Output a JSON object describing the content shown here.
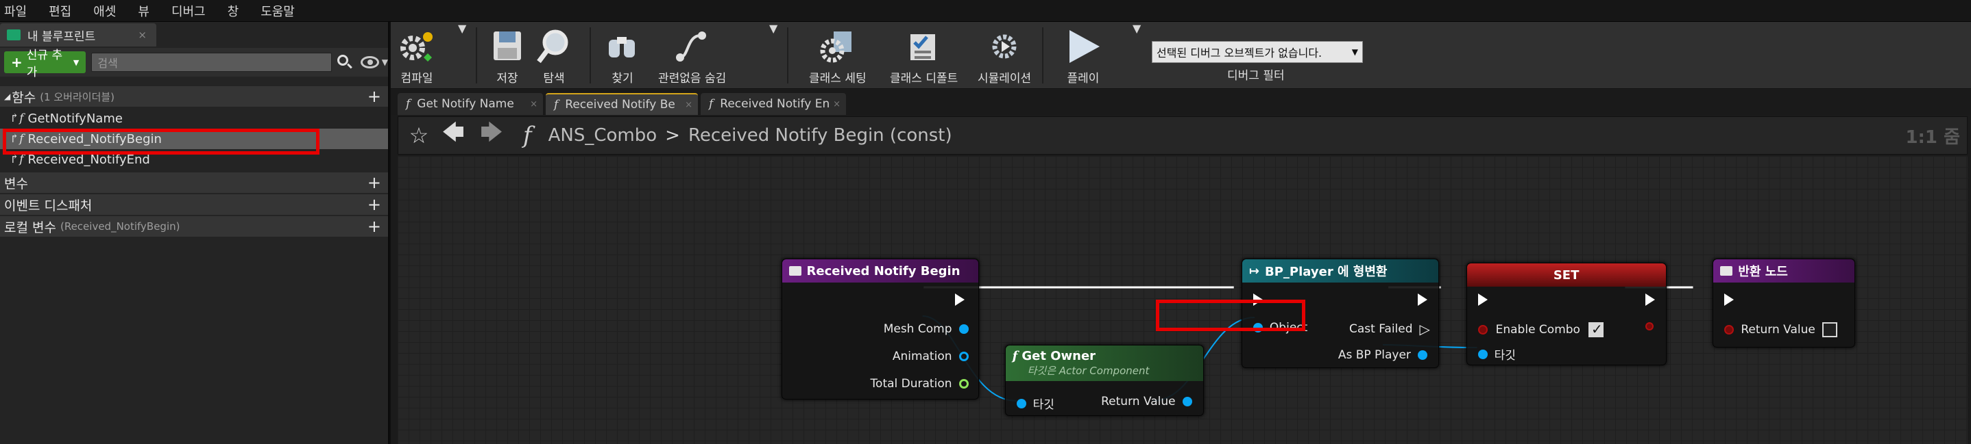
{
  "menu": [
    "파일",
    "편집",
    "애셋",
    "뷰",
    "디버그",
    "창",
    "도움말"
  ],
  "left_panel": {
    "tab_title": "내 블루프린트",
    "tab_close": "×",
    "add_new_label": "신규 추가",
    "search_placeholder": "검색",
    "functions": {
      "header": "함수",
      "subtext": "(1 오버라이더블)",
      "items": [
        "GetNotifyName",
        "Received_NotifyBegin",
        "Received_NotifyEnd"
      ],
      "selected_index": 1
    },
    "variables_header": "변수",
    "event_dispatchers_header": "이벤트 디스패처",
    "local_variables": {
      "header": "로컬 변수",
      "subtext": "(Received_NotifyBegin)"
    },
    "plus_symbol": "+"
  },
  "toolbar": {
    "compile": "컴파일",
    "save": "저장",
    "browse": "탐색",
    "find": "찾기",
    "hide_unrelated": "관련없음 숨김",
    "class_settings": "클래스 세팅",
    "class_defaults": "클래스 디폴트",
    "simulation": "시뮬레이션",
    "play": "플레이",
    "debug_object": "선택된 디버그 오브젝트가 없습니다.",
    "debug_filter": "디버그 필터"
  },
  "doc_tabs": [
    "Get Notify Name",
    "Received Notify Be",
    "Received Notify En"
  ],
  "active_tab_index": 1,
  "graph_nav": {
    "class_name": "ANS_Combo",
    "separator": ">",
    "function_name": "Received Notify Begin (const)",
    "zoom": "1:1 줌"
  },
  "nodes": {
    "entry": {
      "title": "Received Notify Begin",
      "pins": [
        "Mesh Comp",
        "Animation",
        "Total Duration"
      ],
      "color": "#6a1e80"
    },
    "get_owner": {
      "title": "Get Owner",
      "subtitle": "타깃은 Actor Component",
      "target": "타깃",
      "return_value": "Return Value",
      "color": "#2f6e34"
    },
    "cast": {
      "title": "BP_Player 에 형변환",
      "object_pin": "Object",
      "cast_failed": "Cast Failed",
      "as_pin": "As BP Player",
      "color": "#166e78"
    },
    "set": {
      "title": "SET",
      "enable_combo": "Enable Combo",
      "enable_combo_value": true,
      "target": "타깃",
      "color": "#a51a1a"
    },
    "return": {
      "title": "반환 노드",
      "return_value": "Return Value",
      "return_checked": false,
      "color": "#6a1e80"
    }
  },
  "colors": {
    "highlight": "#e60000",
    "exec_pin": "#ffffff",
    "object_pin": "#08a6f4",
    "float_pin": "#8ee45a",
    "bool_pin": "#b01010"
  }
}
